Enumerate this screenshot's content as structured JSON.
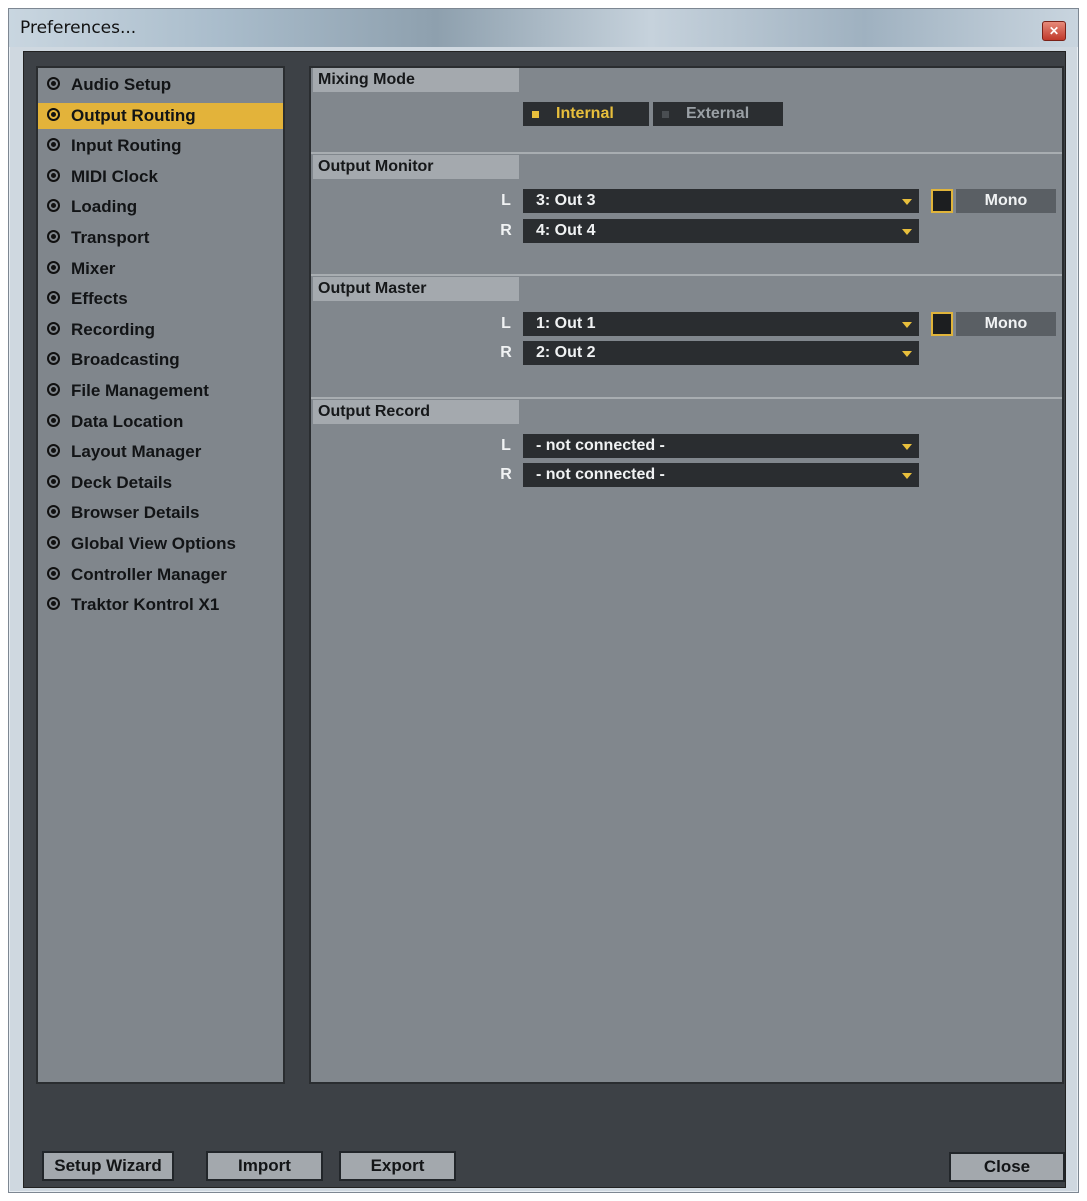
{
  "window": {
    "title": "Preferences..."
  },
  "sidebar": {
    "items": [
      {
        "label": "Audio Setup",
        "active": false
      },
      {
        "label": "Output Routing",
        "active": true
      },
      {
        "label": "Input Routing",
        "active": false
      },
      {
        "label": "MIDI Clock",
        "active": false
      },
      {
        "label": "Loading",
        "active": false
      },
      {
        "label": "Transport",
        "active": false
      },
      {
        "label": "Mixer",
        "active": false
      },
      {
        "label": "Effects",
        "active": false
      },
      {
        "label": "Recording",
        "active": false
      },
      {
        "label": "Broadcasting",
        "active": false
      },
      {
        "label": "File Management",
        "active": false
      },
      {
        "label": "Data Location",
        "active": false
      },
      {
        "label": "Layout Manager",
        "active": false
      },
      {
        "label": "Deck Details",
        "active": false
      },
      {
        "label": "Browser Details",
        "active": false
      },
      {
        "label": "Global View Options",
        "active": false
      },
      {
        "label": "Controller Manager",
        "active": false
      },
      {
        "label": "Traktor Kontrol X1",
        "active": false
      }
    ]
  },
  "mixing_mode": {
    "header": "Mixing Mode",
    "options": [
      {
        "label": "Internal",
        "selected": true
      },
      {
        "label": "External",
        "selected": false
      }
    ]
  },
  "output_monitor": {
    "header": "Output Monitor",
    "left_label": "L",
    "right_label": "R",
    "left_value": "3: Out 3",
    "right_value": "4: Out 4",
    "mono_label": "Mono"
  },
  "output_master": {
    "header": "Output Master",
    "left_label": "L",
    "right_label": "R",
    "left_value": "1: Out 1",
    "right_value": "2: Out 2",
    "mono_label": "Mono"
  },
  "output_record": {
    "header": "Output Record",
    "left_label": "L",
    "right_label": "R",
    "left_value": "- not connected -",
    "right_value": "- not connected -"
  },
  "footer": {
    "setup_wizard": "Setup Wizard",
    "import": "Import",
    "export": "Export",
    "close": "Close"
  },
  "colors": {
    "accent": "#e3b33a",
    "panel": "#81878d",
    "frame": "#3d4146",
    "dropdown": "#2a2d30"
  }
}
